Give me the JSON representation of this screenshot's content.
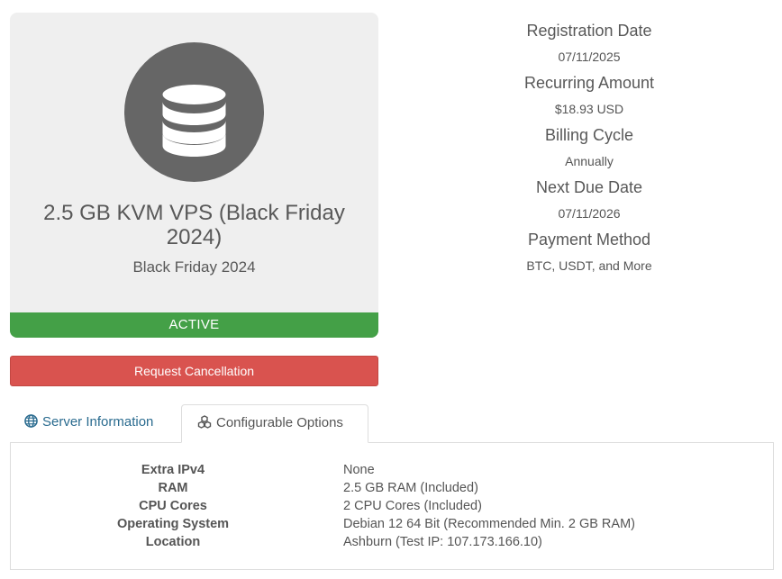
{
  "product": {
    "icon": "database-icon",
    "name": "2.5 GB KVM VPS (Black Friday 2024)",
    "group": "Black Friday 2024",
    "status": "ACTIVE"
  },
  "actions": {
    "cancel_label": "Request Cancellation"
  },
  "billing": {
    "registration_label": "Registration Date",
    "registration_value": "07/11/2025",
    "recurring_label": "Recurring Amount",
    "recurring_value": "$18.93 USD",
    "cycle_label": "Billing Cycle",
    "cycle_value": "Annually",
    "due_label": "Next Due Date",
    "due_value": "07/11/2026",
    "payment_label": "Payment Method",
    "payment_value": "BTC, USDT, and More"
  },
  "tabs": {
    "server_info": {
      "label": "Server Information",
      "icon": "globe-icon"
    },
    "config_options": {
      "label": "Configurable Options",
      "icon": "cubes-icon"
    }
  },
  "options": [
    {
      "label": "Extra IPv4",
      "value": "None"
    },
    {
      "label": "RAM",
      "value": "2.5 GB RAM (Included)"
    },
    {
      "label": "CPU Cores",
      "value": "2 CPU Cores (Included)"
    },
    {
      "label": "Operating System",
      "value": "Debian 12 64 Bit (Recommended Min. 2 GB RAM)"
    },
    {
      "label": "Location",
      "value": "Ashburn (Test IP: 107.173.166.10)"
    }
  ],
  "colors": {
    "active": "#44a047",
    "cancel": "#d9534f",
    "link": "#2a6b8f"
  }
}
